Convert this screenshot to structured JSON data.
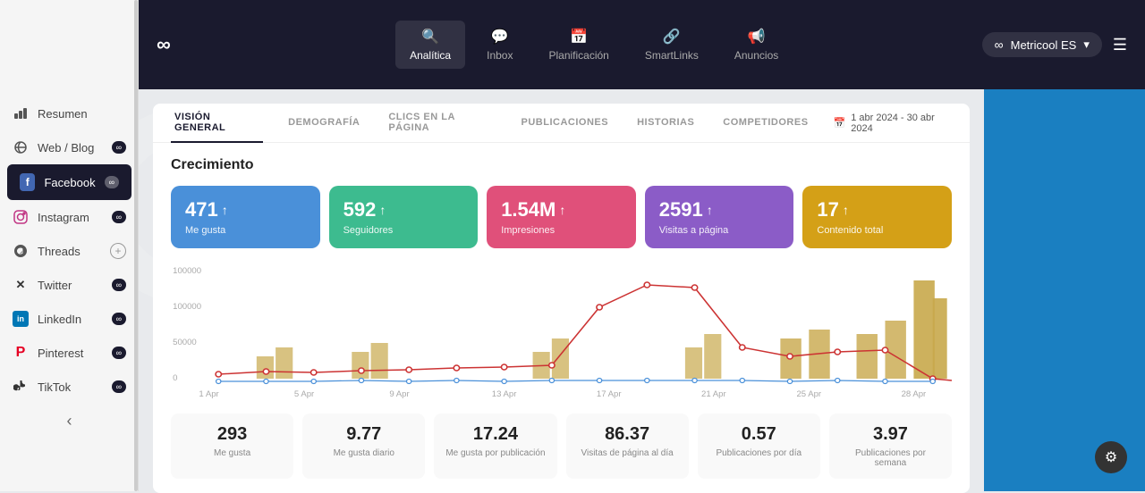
{
  "app": {
    "logo": "∞",
    "logo_label": "Metricool"
  },
  "topnav": {
    "tabs": [
      {
        "id": "analytics",
        "label": "Analítica",
        "icon": "🔍",
        "active": true
      },
      {
        "id": "inbox",
        "label": "Inbox",
        "icon": "💬",
        "active": false
      },
      {
        "id": "planning",
        "label": "Planificación",
        "icon": "📅",
        "active": false
      },
      {
        "id": "smartlinks",
        "label": "SmartLinks",
        "icon": "🔗",
        "active": false
      },
      {
        "id": "ads",
        "label": "Anuncios",
        "icon": "📢",
        "active": false
      }
    ],
    "account": "Metricool ES",
    "account_icon": "∞"
  },
  "sidebar": {
    "items": [
      {
        "id": "resumen",
        "label": "Resumen",
        "icon": "📊",
        "badge": null,
        "add": false
      },
      {
        "id": "web-blog",
        "label": "Web / Blog",
        "icon": "📡",
        "badge": "∞",
        "add": false
      },
      {
        "id": "facebook",
        "label": "Facebook",
        "icon": "f",
        "badge": "∞",
        "add": false,
        "active": true
      },
      {
        "id": "instagram",
        "label": "Instagram",
        "icon": "◎",
        "badge": "∞",
        "add": false
      },
      {
        "id": "threads",
        "label": "Threads",
        "icon": "⊕",
        "badge": null,
        "add": true
      },
      {
        "id": "twitter",
        "label": "Twitter",
        "icon": "✕",
        "badge": "∞",
        "add": false
      },
      {
        "id": "linkedin",
        "label": "LinkedIn",
        "icon": "in",
        "badge": "∞",
        "add": false
      },
      {
        "id": "pinterest",
        "label": "Pinterest",
        "icon": "P",
        "badge": "∞",
        "add": false
      },
      {
        "id": "tiktok",
        "label": "TikTok",
        "icon": "♪",
        "badge": "∞",
        "add": false
      }
    ],
    "collapse_icon": "‹"
  },
  "subnav": {
    "items": [
      {
        "id": "vision-general",
        "label": "VISIÓN GENERAL",
        "active": true
      },
      {
        "id": "demografia",
        "label": "DEMOGRAFÍA",
        "active": false
      },
      {
        "id": "clics",
        "label": "CLICS EN LA PÁGINA",
        "active": false
      },
      {
        "id": "publicaciones",
        "label": "PUBLICACIONES",
        "active": false
      },
      {
        "id": "historias",
        "label": "HISTORIAS",
        "active": false
      },
      {
        "id": "competidores",
        "label": "COMPETIDORES",
        "active": false
      }
    ],
    "date_range": "1 abr 2024 - 30 abr 2024",
    "calendar_icon": "📅"
  },
  "growth": {
    "title": "Crecimiento",
    "metrics": [
      {
        "id": "me-gusta",
        "value": "471",
        "arrow": "↑",
        "label": "Me gusta",
        "color": "blue"
      },
      {
        "id": "seguidores",
        "value": "592",
        "arrow": "↑",
        "label": "Seguidores",
        "color": "green"
      },
      {
        "id": "impresiones",
        "value": "1.54M",
        "arrow": "↑",
        "label": "Impresiones",
        "color": "pink"
      },
      {
        "id": "visitas",
        "value": "2591",
        "arrow": "↑",
        "label": "Visitas a página",
        "color": "purple"
      },
      {
        "id": "contenido",
        "value": "17",
        "arrow": "↑",
        "label": "Contenido total",
        "color": "gold"
      }
    ],
    "chart": {
      "y_labels": [
        "100000",
        "100000",
        "50000",
        "0"
      ],
      "x_labels": [
        "1 Apr",
        "5 Apr",
        "9 Apr",
        "13 Apr",
        "17 Apr",
        "21 Apr",
        "25 Apr",
        "28 Apr"
      ]
    }
  },
  "bottom_stats": [
    {
      "id": "me-gusta",
      "value": "293",
      "label": "Me gusta"
    },
    {
      "id": "me-gusta-diario",
      "value": "9.77",
      "label": "Me gusta diario"
    },
    {
      "id": "me-gusta-publicacion",
      "value": "17.24",
      "label": "Me gusta por publicación"
    },
    {
      "id": "visitas-dia",
      "value": "86.37",
      "label": "Visitas de página al día"
    },
    {
      "id": "publicaciones-dia",
      "value": "0.57",
      "label": "Publicaciones por día"
    },
    {
      "id": "publicaciones-semana",
      "value": "3.97",
      "label": "Publicaciones por semana"
    }
  ],
  "settings": {
    "icon": "⚙"
  }
}
